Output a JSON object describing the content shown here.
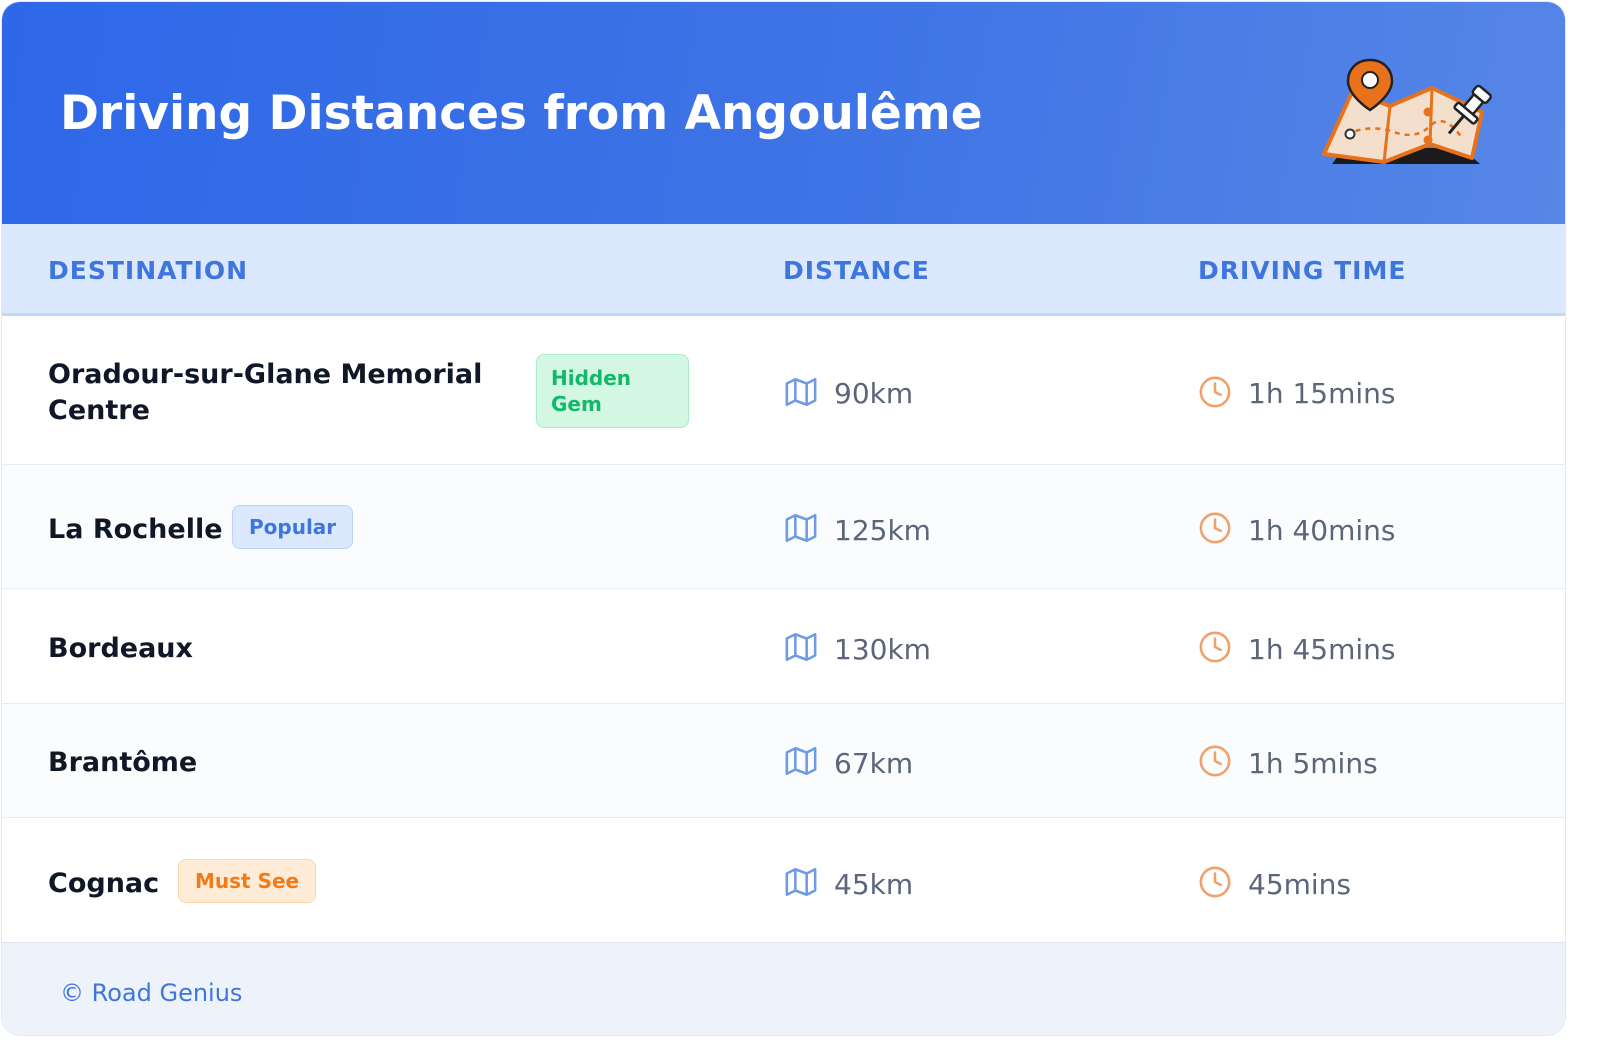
{
  "header": {
    "title": "Driving Distances from Angoulême"
  },
  "icons": {
    "illustration": "map-with-pins-illustration",
    "distance": "map-icon",
    "time": "clock-icon"
  },
  "columns": {
    "destination": "DESTINATION",
    "distance": "DISTANCE",
    "driving_time": "DRIVING TIME"
  },
  "rows": [
    {
      "destination": "Oradour-sur-Glane Memorial Centre",
      "badge": "Hidden Gem",
      "distance": "90km",
      "time": "1h 15mins"
    },
    {
      "destination": "La Rochelle",
      "badge": "Popular",
      "distance": "125km",
      "time": "1h 40mins"
    },
    {
      "destination": "Bordeaux",
      "badge": "",
      "distance": "130km",
      "time": "1h 45mins"
    },
    {
      "destination": "Brantôme",
      "badge": "",
      "distance": "67km",
      "time": "1h 5mins"
    },
    {
      "destination": "Cognac",
      "badge": "Must See",
      "distance": "45km",
      "time": "45mins"
    }
  ],
  "footer": {
    "credit": "© Road Genius"
  },
  "colors": {
    "header_blue": "#3a6fe6",
    "accent_blue": "#3f76de",
    "green": "#14b86b",
    "orange": "#f07b18",
    "clock_orange": "#f0a06a"
  }
}
